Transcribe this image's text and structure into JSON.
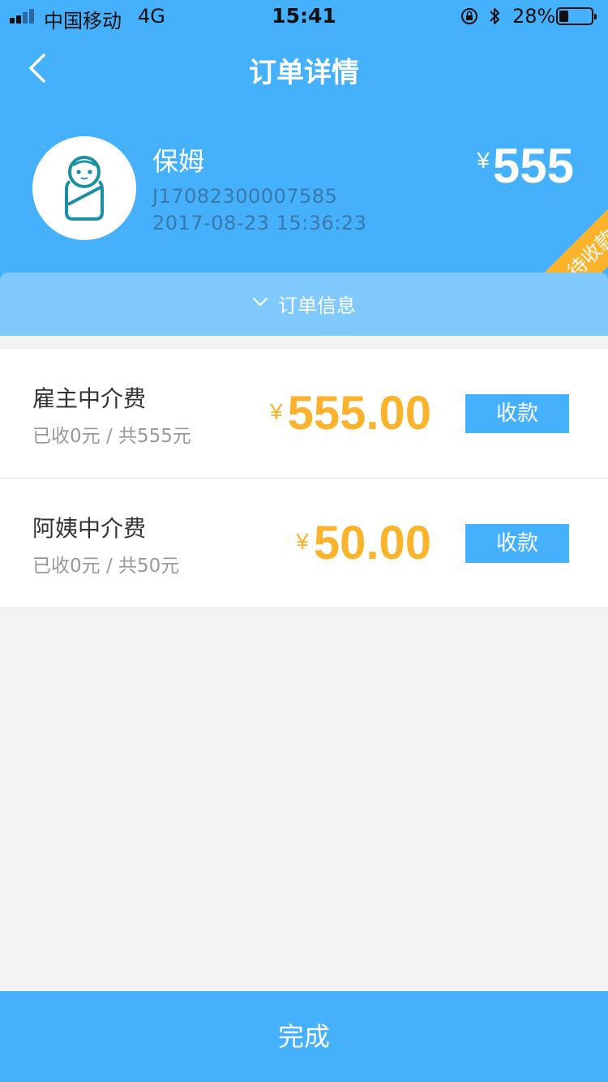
{
  "status_bar": {
    "carrier": "中国移动",
    "network": "4G",
    "time": "15:41",
    "battery_percent": "28%",
    "battery_level": 0.28
  },
  "nav": {
    "title": "订单详情",
    "back_icon": "chevron-left-icon"
  },
  "order": {
    "service_name": "保姆",
    "order_number": "J17082300007585",
    "created_at": "2017-08-23 15:36:23",
    "currency_symbol": "¥",
    "total": "555",
    "status_ribbon": "待收款",
    "avatar_icon": "swaddled-baby-icon"
  },
  "info_toggle": {
    "label": "订单信息",
    "icon": "chevron-down-icon"
  },
  "fees": [
    {
      "name": "雇主中介费",
      "progress": "已收0元 / 共555元",
      "currency_symbol": "¥",
      "amount": "555.00",
      "button_label": "收款"
    },
    {
      "name": "阿姨中介费",
      "progress": "已收0元 / 共50元",
      "currency_symbol": "¥",
      "amount": "50.00",
      "button_label": "收款"
    }
  ],
  "footer": {
    "done_label": "完成"
  },
  "colors": {
    "primary": "#45b0fb",
    "info_bar": "#80c9fc",
    "accent_amount": "#fcb32c",
    "ribbon": "#fcb32c",
    "background": "#f3f3f3",
    "avatar_icon": "#1b8fa3"
  }
}
